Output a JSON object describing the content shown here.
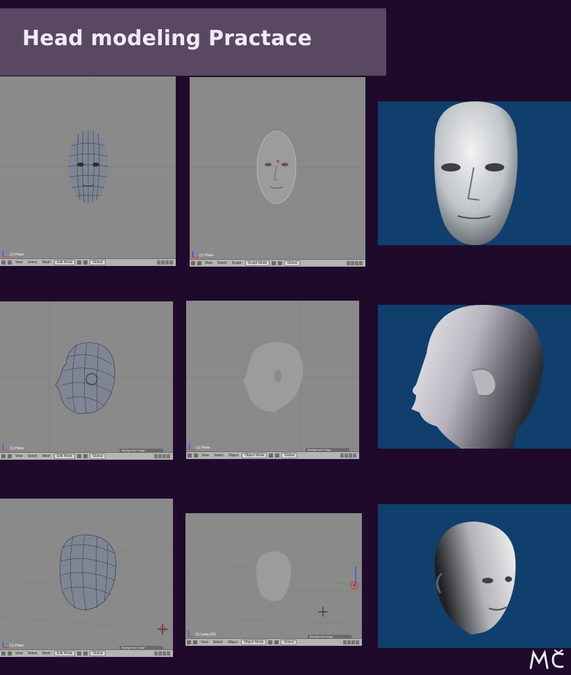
{
  "title": "Head modeling Practace",
  "menus": {
    "view": "View",
    "select": "Select",
    "mesh": "Mesh",
    "sculpt": "Sculpt",
    "object": "Object"
  },
  "modes": {
    "edit": "Edit Mode",
    "sculpt": "Sculpt Mode",
    "object": "Object Mode"
  },
  "orientation": "Global",
  "object_names": {
    "plane": "(1) Plane",
    "lamp": "(1) Lamp.001"
  },
  "background_image_label": "Background Image",
  "colors": {
    "page_bg": "#1f0a2b",
    "banner_bg": "#5a4761",
    "viewport_bg": "#8a8a8a",
    "render_bg": "#103f6e",
    "title_text": "#f3e9f5"
  }
}
